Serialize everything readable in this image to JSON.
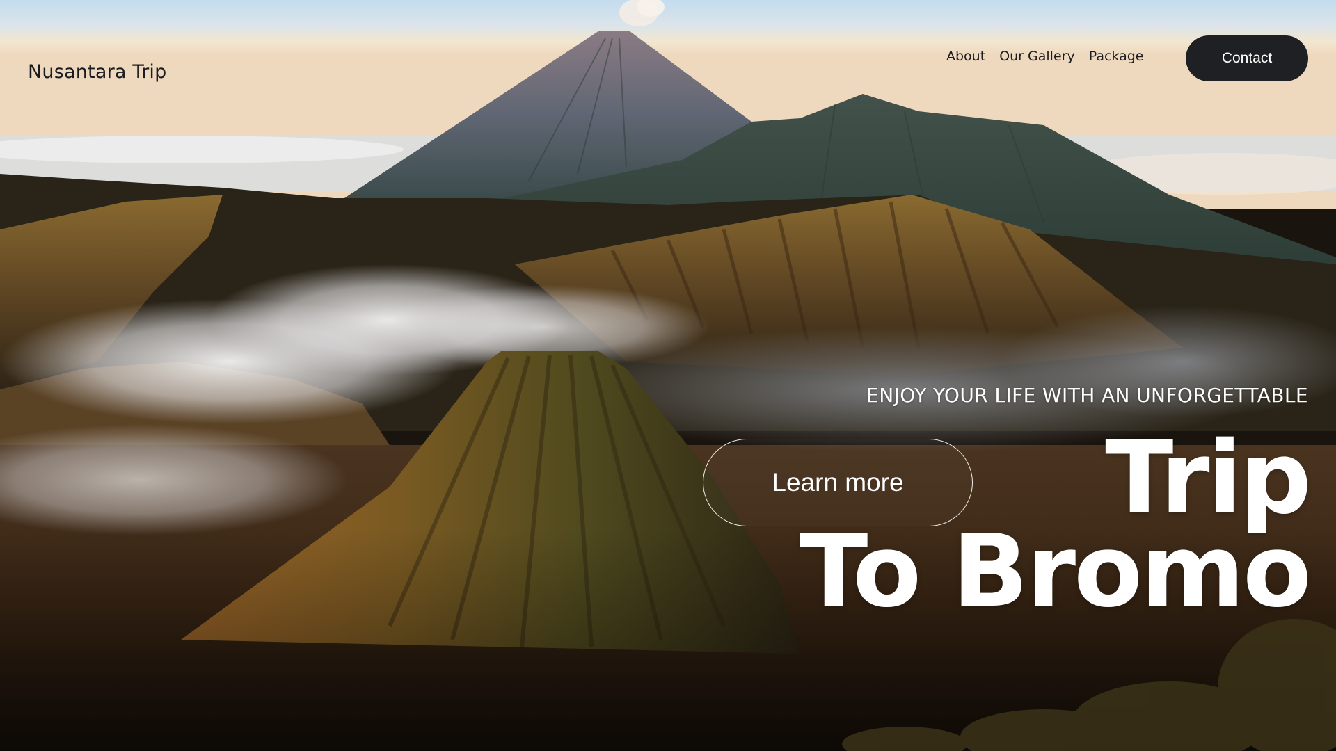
{
  "header": {
    "brand": "Nusantara Trip",
    "nav": [
      {
        "label": "About"
      },
      {
        "label": "Our Gallery"
      },
      {
        "label": "Package"
      }
    ],
    "contact_label": "Contact"
  },
  "hero": {
    "tagline": "ENJOY YOUR LIFE WITH AN UNFORGETTABLE",
    "headline_line1": "Trip",
    "headline_line2": "To Bromo",
    "cta_label": "Learn more"
  },
  "colors": {
    "text_dark": "#1b1c20",
    "button_dark": "#1f2023",
    "text_light": "#ffffff"
  }
}
